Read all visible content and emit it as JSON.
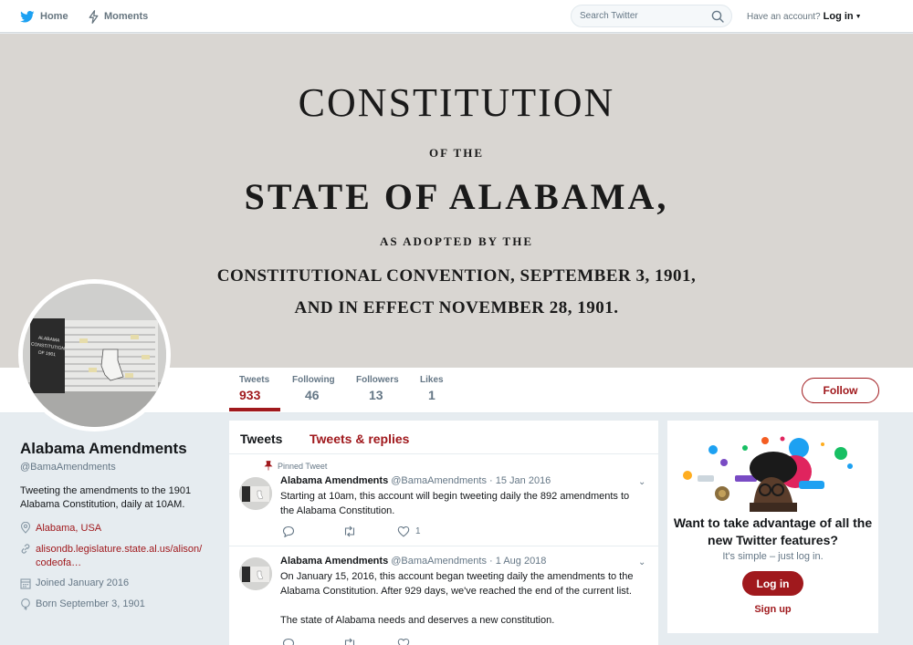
{
  "nav": {
    "home_label": "Home",
    "moments_label": "Moments",
    "search_placeholder": "Search Twitter",
    "account_prompt": "Have an account?",
    "login_label": "Log in",
    "brand_color": "#1da1f2"
  },
  "banner": {
    "line1": "CONSTITUTION",
    "line2": "OF THE",
    "line3": "STATE OF ALABAMA,",
    "line4": "AS ADOPTED BY THE",
    "line5": "CONSTITUTIONAL CONVENTION, SEPTEMBER 3, 1901,",
    "line6": "AND IN EFFECT NOVEMBER 28, 1901."
  },
  "stats": [
    {
      "label": "Tweets",
      "value": "933"
    },
    {
      "label": "Following",
      "value": "46"
    },
    {
      "label": "Followers",
      "value": "13"
    },
    {
      "label": "Likes",
      "value": "1"
    }
  ],
  "follow_label": "Follow",
  "profile": {
    "name": "Alabama Amendments",
    "handle": "@BamaAmendments",
    "bio": "Tweeting the amendments to the 1901 Alabama Constitution, daily at 10AM.",
    "location": "Alabama, USA",
    "website_line1": "alisondb.legislature.state.al.us/alison/",
    "website_line2": "codeofa…",
    "joined": "Joined January 2016",
    "born": "Born September 3, 1901",
    "avatar_text": "ALABAMA CONSTITUTION OF 1901"
  },
  "timeline": {
    "tab1": "Tweets",
    "tab2": "Tweets & replies",
    "pinned_label": "Pinned Tweet",
    "tweets": [
      {
        "name": "Alabama Amendments",
        "handle": "@BamaAmendments",
        "date": "· 15 Jan 2016",
        "text": "Starting at 10am, this account will begin tweeting daily the 892 amendments to the Alabama Constitution.",
        "likes": "1"
      },
      {
        "name": "Alabama Amendments",
        "handle": "@BamaAmendments",
        "date": "· 1 Aug 2018",
        "text": "On January 15, 2016, this account began tweeting daily the amendments to the Alabama Constitution. After 929 days, we've reached the end of the current list.",
        "text2": "The state of Alabama needs and deserves a new constitution."
      }
    ]
  },
  "card": {
    "title": "Want to take advantage of all the new Twitter features?",
    "subtitle": "It's simple – just log in.",
    "login_label": "Log in",
    "signup_label": "Sign up"
  },
  "colors": {
    "accent": "#a0191d",
    "background": "#e6ecf0"
  }
}
